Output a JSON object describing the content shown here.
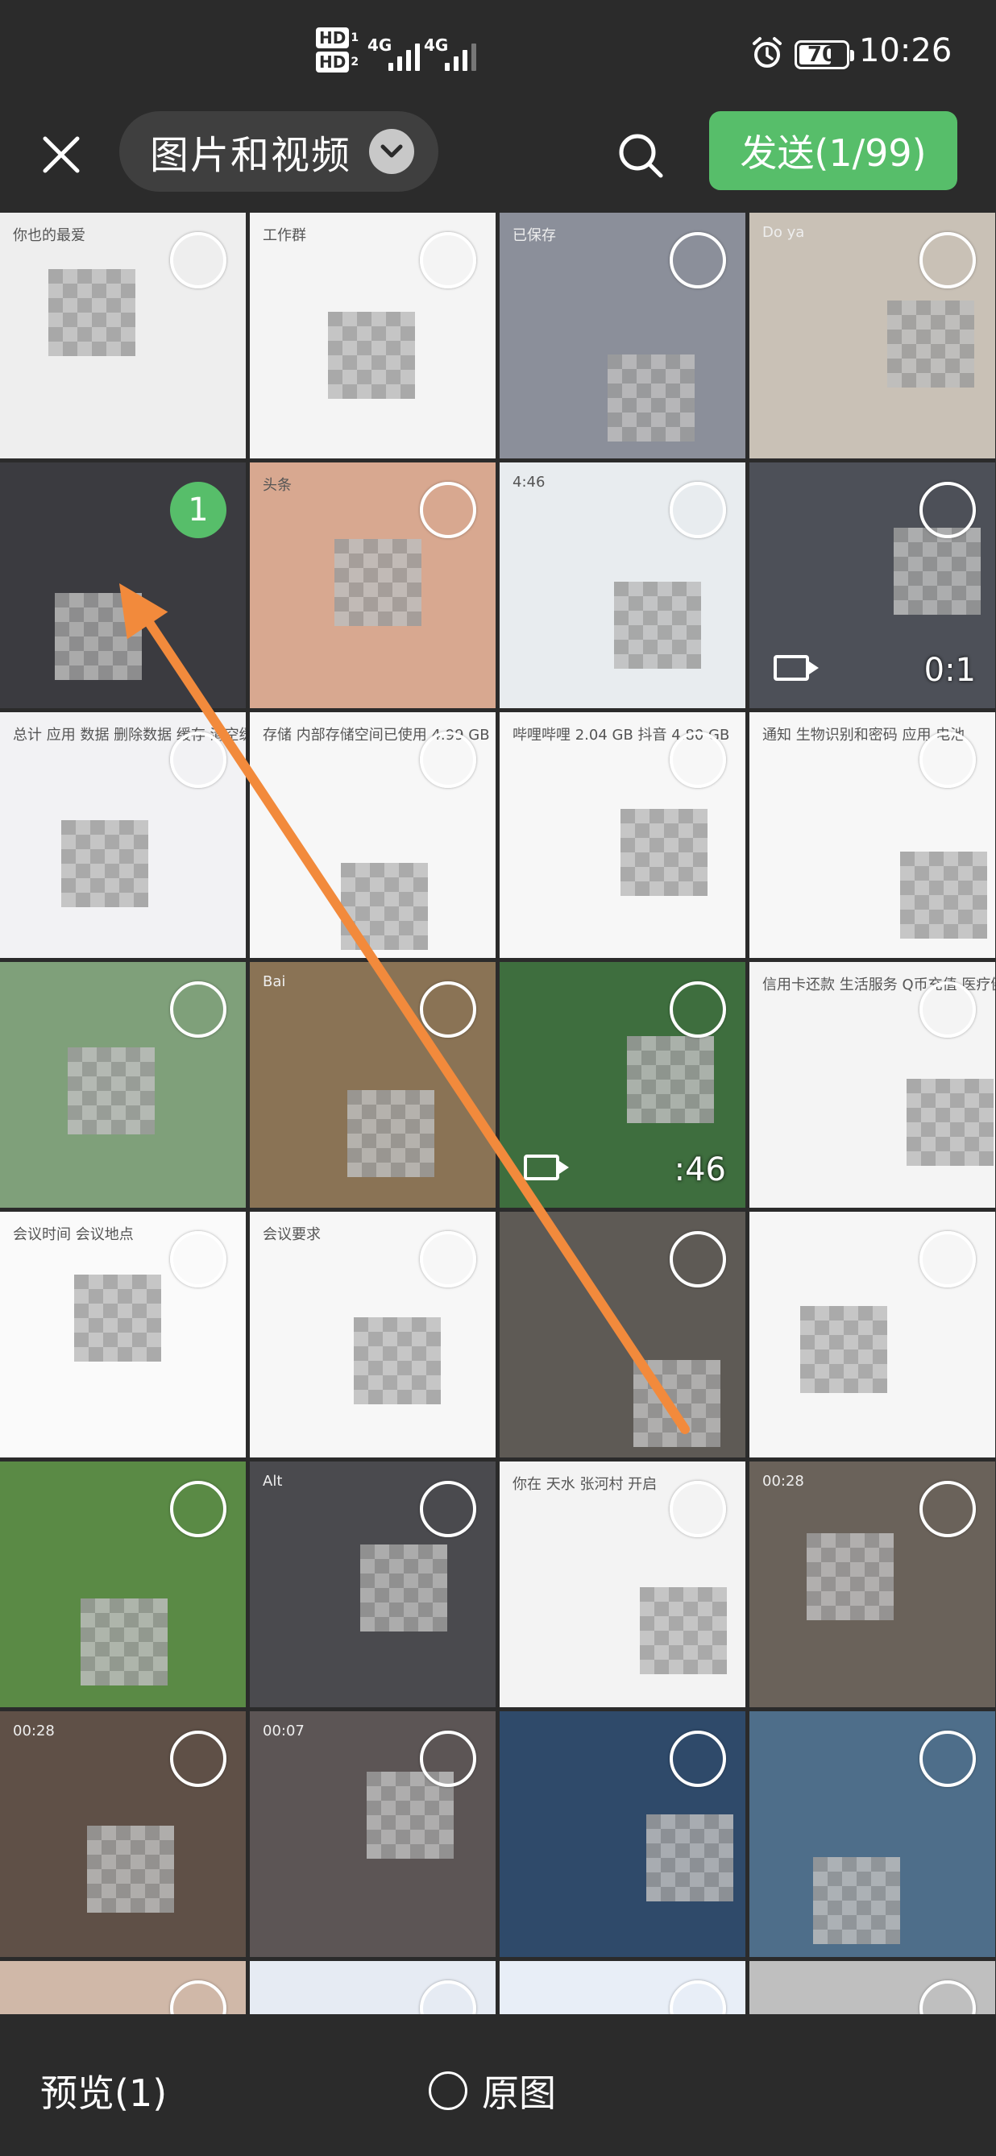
{
  "status_bar": {
    "sim1": {
      "hd": "HD",
      "slot": "1",
      "network": "4G",
      "signal_bars": 4
    },
    "sim2": {
      "hd": "HD",
      "slot": "2",
      "network": "4G",
      "signal_bars": 3
    },
    "alarm_icon": "alarm-clock-icon",
    "battery_percent": "70",
    "time": "10:26"
  },
  "header": {
    "close_icon": "close-icon",
    "album_title": "图片和视频",
    "album_chevron_icon": "chevron-down-icon",
    "search_icon": "search-icon",
    "send_label": "发送(1/99)"
  },
  "grid": {
    "columns": 4,
    "tiles": [
      {
        "kind": "chat-screenshot",
        "bg": "#eeeeee",
        "snippet": "你也的最爱"
      },
      {
        "kind": "chat-list",
        "bg": "#f4f4f4",
        "snippet": "工作群"
      },
      {
        "kind": "photo",
        "bg": "#8b8f9a",
        "snippet": "已保存"
      },
      {
        "kind": "photo",
        "bg": "#c9c1b6",
        "snippet": "Do ya"
      },
      {
        "kind": "photo",
        "bg": "#3b3b40",
        "selected": true,
        "badge": "1"
      },
      {
        "kind": "home-screen",
        "bg": "#d8a890",
        "snippet": "头条"
      },
      {
        "kind": "settings",
        "bg": "#e8ecef",
        "snippet": "4:46"
      },
      {
        "kind": "video",
        "bg": "#4d5058",
        "duration": "0:1"
      },
      {
        "kind": "settings",
        "bg": "#f2f2f4",
        "snippet": "总计  应用  数据  删除数据  缓存  清空缓存"
      },
      {
        "kind": "settings",
        "bg": "#f7f7f7",
        "snippet": "存储  内部存储空间已使用 4.99 GB"
      },
      {
        "kind": "settings",
        "bg": "#f7f7f7",
        "snippet": "哔哩哔哩 2.04 GB  抖音 4.80 GB"
      },
      {
        "kind": "settings",
        "bg": "#f7f7f7",
        "snippet": "通知  生物识别和密码  应用  电池"
      },
      {
        "kind": "home-screen",
        "bg": "#7fa07a",
        "snippet": ""
      },
      {
        "kind": "photo",
        "bg": "#8a7355",
        "snippet": "Bai"
      },
      {
        "kind": "video",
        "bg": "#3e6e3e",
        "duration": ":46"
      },
      {
        "kind": "settings",
        "bg": "#f4f4f4",
        "snippet": "信用卡还款  生活服务  Q币充值  医疗健康"
      },
      {
        "kind": "document",
        "bg": "#fafafa",
        "snippet": "会议时间  会议地点"
      },
      {
        "kind": "document",
        "bg": "#f7f7f7",
        "snippet": "会议要求"
      },
      {
        "kind": "photo",
        "bg": "#5e5a55",
        "snippet": ""
      },
      {
        "kind": "chat-screenshot",
        "bg": "#f6f6f6",
        "snippet": ""
      },
      {
        "kind": "photo",
        "bg": "#5a8a45",
        "snippet": ""
      },
      {
        "kind": "photo",
        "bg": "#4a4a4e",
        "snippet": "Alt"
      },
      {
        "kind": "map",
        "bg": "#f3f3f3",
        "snippet": "你在  天水  张河村  开启"
      },
      {
        "kind": "video-collage",
        "bg": "#6a625a",
        "snippet": "00:28"
      },
      {
        "kind": "video-collage",
        "bg": "#5f5047",
        "snippet": "00:28"
      },
      {
        "kind": "video-collage",
        "bg": "#5c5555",
        "snippet": "00:07"
      },
      {
        "kind": "video-collage",
        "bg": "#2f4a6a",
        "snippet": ""
      },
      {
        "kind": "photo",
        "bg": "#4e6e8a",
        "snippet": ""
      },
      {
        "kind": "photo",
        "bg": "#d0b8a8",
        "snippet": ""
      },
      {
        "kind": "document",
        "bg": "#e6ebf3",
        "snippet": ""
      },
      {
        "kind": "document",
        "bg": "#e8eef7",
        "snippet": ""
      },
      {
        "kind": "photo",
        "bg": "#bfbfbf",
        "snippet": ""
      }
    ]
  },
  "annotation": {
    "arrow_color": "#f28a3c",
    "from_tile": 22,
    "to_tile": 4
  },
  "footer": {
    "preview_label": "预览(1)",
    "original_label": "原图",
    "original_checked": false
  },
  "colors": {
    "accent_green": "#57be6a",
    "bar_background": "#2b2b2b"
  }
}
